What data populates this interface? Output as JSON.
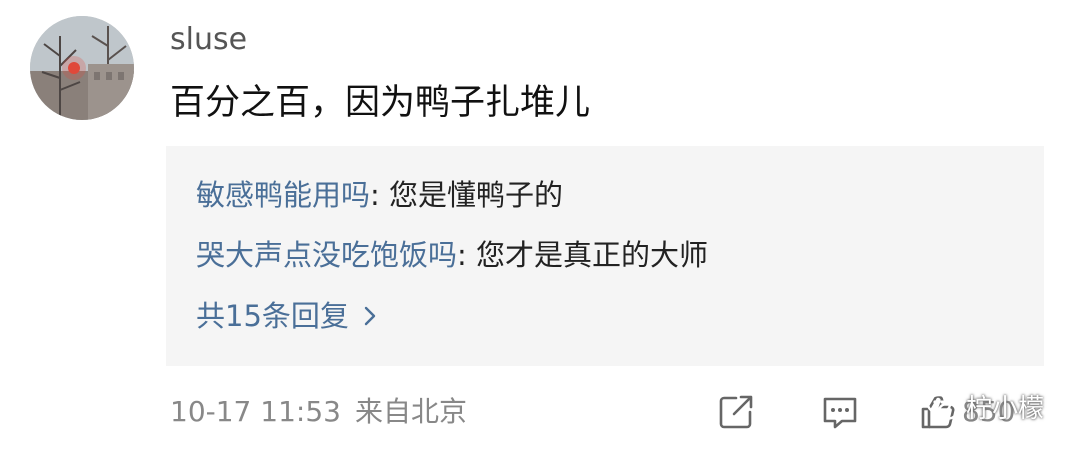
{
  "comment": {
    "username": "sluse",
    "text": "百分之百，因为鸭子扎堆儿",
    "avatar_icon": "avatar-photo-icon",
    "replies": [
      {
        "name": "敏感鸭能用吗",
        "separator": ": ",
        "text": "您是懂鸭子的"
      },
      {
        "name": "哭大声点没吃饱饭吗",
        "separator": ": ",
        "text": "您才是真正的大师"
      }
    ],
    "more_replies_label": "共15条回复",
    "date": "10-17 11:53",
    "location": "来自北京",
    "like_count": "850"
  },
  "actions": {
    "share_icon": "share-icon",
    "comment_icon": "comment-icon",
    "like_icon": "like-icon"
  },
  "watermark": {
    "text": "柠小檬",
    "icon": "wechat-icon"
  },
  "colors": {
    "link": "#4a6f98",
    "text_primary": "#111111",
    "text_muted": "#888888",
    "reply_bg": "#f5f5f5"
  }
}
